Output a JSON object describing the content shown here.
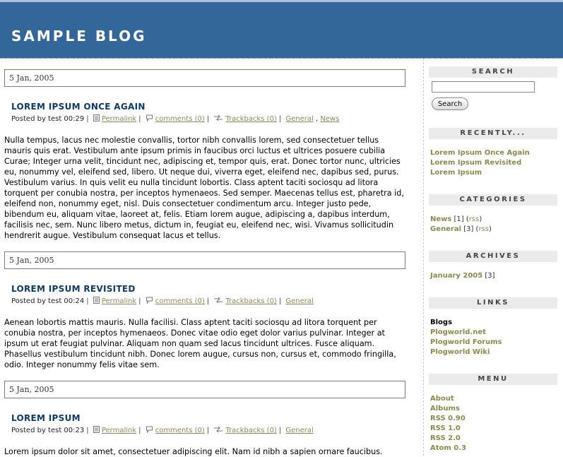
{
  "header": {
    "title": "SAMPLE BLOG"
  },
  "posts": [
    {
      "date": "5 Jan, 2005",
      "title": "LOREM IPSUM ONCE AGAIN",
      "posted": "Posted by test 00:29",
      "permalink": "Permalink",
      "comments": "comments (0)",
      "trackbacks": "Trackbacks (0)",
      "categories": [
        "General",
        "News"
      ],
      "body": "Nulla tempus, lacus nec molestie convallis, tortor nibh convallis lorem, sed consectetuer tellus mauris quis erat. Vestibulum ante ipsum primis in faucibus orci luctus et ultrices posuere cubilia Curae; Integer urna velit, tincidunt nec, adipiscing et, tempor quis, erat. Donec tortor nunc, ultricies eu, nonummy vel, eleifend sed, libero. Ut neque dui, viverra eget, eleifend nec, dapibus sed, purus. Vestibulum varius. In quis velit eu nulla tincidunt lobortis. Class aptent taciti sociosqu ad litora torquent per conubia nostra, per inceptos hymenaeos. Sed semper. Maecenas tellus est, pharetra id, eleifend non, nonummy eget, nisl. Duis consectetuer condimentum arcu. Integer justo pede, bibendum eu, aliquam vitae, laoreet at, felis. Etiam lorem augue, adipiscing a, dapibus interdum, facilisis nec, sem. Nunc libero metus, dictum in, feugiat eu, eleifend nec, wisi. Vivamus sollicitudin hendrerit augue. Vestibulum consequat lacus et tellus."
    },
    {
      "date": "5 Jan, 2005",
      "title": "LOREM IPSUM REVISITED",
      "posted": "Posted by test 00:24",
      "permalink": "Permalink",
      "comments": "comments (0)",
      "trackbacks": "Trackbacks (0)",
      "categories": [
        "General"
      ],
      "body": "Aenean lobortis mattis mauris. Nulla facilisi. Class aptent taciti sociosqu ad litora torquent per conubia nostra, per inceptos hymenaeos. Donec vitae odio eget dolor varius pulvinar. Integer at ipsum ut erat feugiat pulvinar. Aliquam non quam sed lacus tincidunt ultrices. Fusce aliquam. Phasellus vestibulum tincidunt nibh. Donec lorem augue, cursus non, cursus et, commodo fringilla, odio. Integer nonummy felis vitae sem."
    },
    {
      "date": "5 Jan, 2005",
      "title": "LOREM IPSUM",
      "posted": "Posted by test 00:23",
      "permalink": "Permalink",
      "comments": "comments (0)",
      "trackbacks": "Trackbacks (0)",
      "categories": [
        "General"
      ],
      "body": "Lorem ipsum dolor sit amet, consectetuer adipiscing elit. Nam id nibh a sapien ornare faucibus."
    }
  ],
  "sidebar": {
    "search": {
      "heading": "SEARCH",
      "button": "Search",
      "value": ""
    },
    "recently": {
      "heading": "RECENTLY...",
      "items": [
        "Lorem Ipsum Once Again",
        "Lorem Ipsum Revisited",
        "Lorem Ipsum"
      ]
    },
    "categories": {
      "heading": "CATEGORIES",
      "items": [
        {
          "name": "News",
          "count": "[1]",
          "rss": "rss"
        },
        {
          "name": "General",
          "count": "[3]",
          "rss": "rss"
        }
      ]
    },
    "archives": {
      "heading": "ARCHIVES",
      "items": [
        {
          "name": "January 2005",
          "count": "[3]"
        }
      ]
    },
    "links": {
      "heading": "LINKS",
      "group": "Blogs",
      "items": [
        "Plogworld.net",
        "Plogworld Forums",
        "Plogworld Wiki"
      ]
    },
    "menu": {
      "heading": "MENU",
      "items": [
        "About",
        "Albums",
        "RSS 0.90",
        "RSS 1.0",
        "RSS 2.0",
        "Atom 0.3"
      ]
    }
  }
}
